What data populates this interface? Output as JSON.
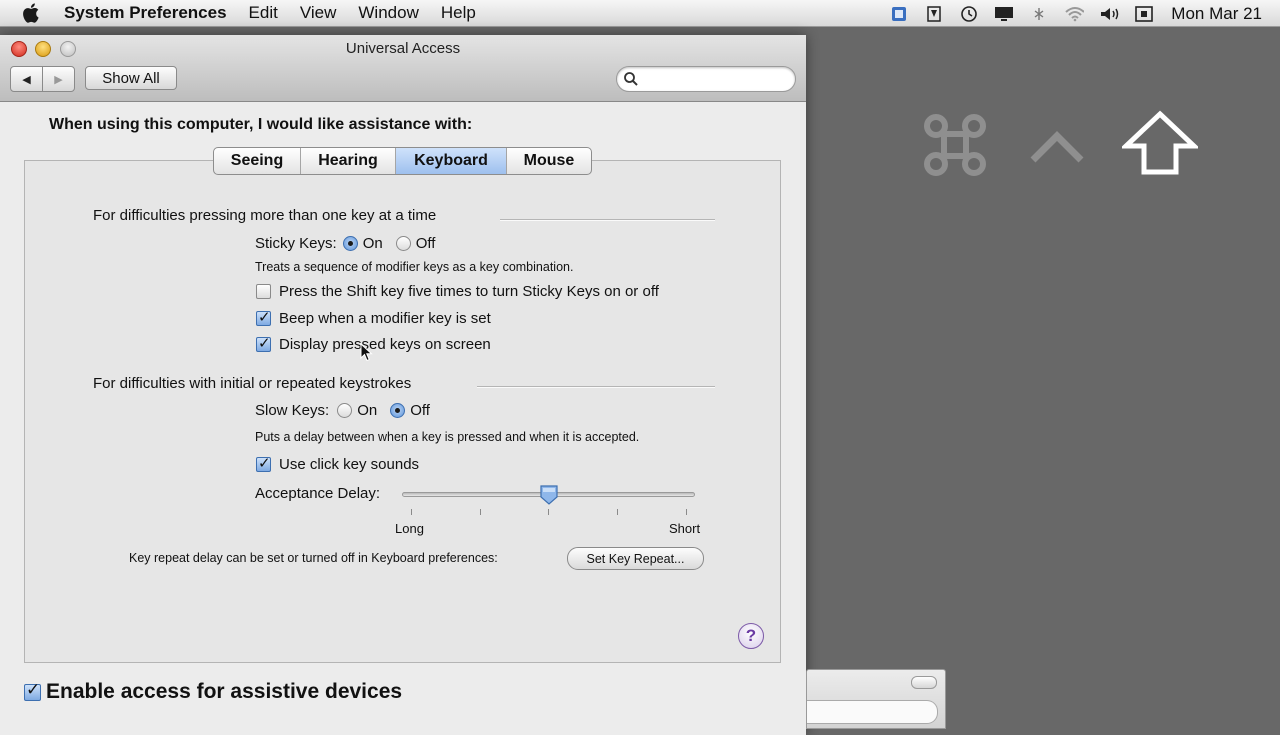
{
  "menubar": {
    "app": "System Preferences",
    "items": [
      "Edit",
      "View",
      "Window",
      "Help"
    ],
    "clock": "Mon Mar 21",
    "status_icons": [
      "spaces-icon",
      "tag-icon",
      "time-machine-icon",
      "display-icon",
      "bluetooth-icon",
      "wifi-icon",
      "volume-icon",
      "input-menu-icon"
    ]
  },
  "window": {
    "title": "Universal Access",
    "show_all": "Show All",
    "search_placeholder": ""
  },
  "heading": "When using this computer, I would like assistance with:",
  "tabs": [
    {
      "label": "Seeing",
      "active": false
    },
    {
      "label": "Hearing",
      "active": false
    },
    {
      "label": "Keyboard",
      "active": true
    },
    {
      "label": "Mouse",
      "active": false
    }
  ],
  "sticky": {
    "section_title": "For difficulties pressing more than one key at a time",
    "label": "Sticky Keys:",
    "on_label": "On",
    "off_label": "Off",
    "value": "On",
    "description": "Treats a sequence of modifier keys as a key combination.",
    "options": [
      {
        "label": "Press the Shift key five times to turn Sticky Keys on or off",
        "checked": false
      },
      {
        "label": "Beep when a modifier key is set",
        "checked": true
      },
      {
        "label": "Display pressed keys on screen",
        "checked": true
      }
    ]
  },
  "slow": {
    "section_title": "For difficulties with initial or repeated keystrokes",
    "label": "Slow Keys:",
    "on_label": "On",
    "off_label": "Off",
    "value": "Off",
    "description": "Puts a delay between when a key is pressed and when it is accepted.",
    "click_sounds_label": "Use click key sounds",
    "click_sounds_checked": true,
    "delay_label": "Acceptance Delay:",
    "delay_value_fraction": 0.5,
    "long_label": "Long",
    "short_label": "Short"
  },
  "key_repeat": {
    "text": "Key repeat delay can be set or turned off in Keyboard preferences:",
    "button": "Set Key Repeat..."
  },
  "help_label": "?",
  "assistive": {
    "label": "Enable access for assistive devices",
    "checked": true
  },
  "pressed_keys": [
    "⌘",
    "^",
    "⇧"
  ],
  "colors": {
    "accent": "#5d93d8",
    "help": "#6a3aa3",
    "desktop": "#686868"
  }
}
